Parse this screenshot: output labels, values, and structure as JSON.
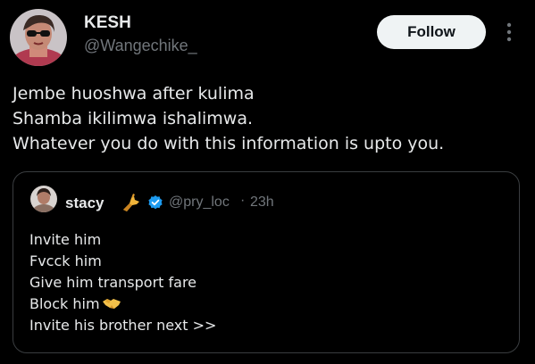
{
  "author": {
    "display_name": "KESH",
    "handle": "@Wangechike_"
  },
  "actions": {
    "follow_label": "Follow"
  },
  "tweet": {
    "lines": [
      "Jembe huoshwa after kulima",
      "Shamba ikilimwa ishalimwa.",
      "Whatever you do with this information is upto you."
    ]
  },
  "quote": {
    "author_name": "stacy",
    "handle": "@pry_loc",
    "separator": "·",
    "time": "23h",
    "lines": [
      "Invite him",
      "Fvcck him",
      "Give him transport fare",
      "Block him",
      "Invite his brother next >>"
    ],
    "name_emoji_icon": "dancing-hand-icon",
    "block_line_emoji_icon": "handshake-icon"
  },
  "colors": {
    "background": "#000000",
    "primary_text": "#e7e9ea",
    "secondary_text": "#71767b",
    "verified": "#1d9bf0",
    "follow_button_bg": "#eff3f4",
    "card_border": "#3a3d40"
  }
}
